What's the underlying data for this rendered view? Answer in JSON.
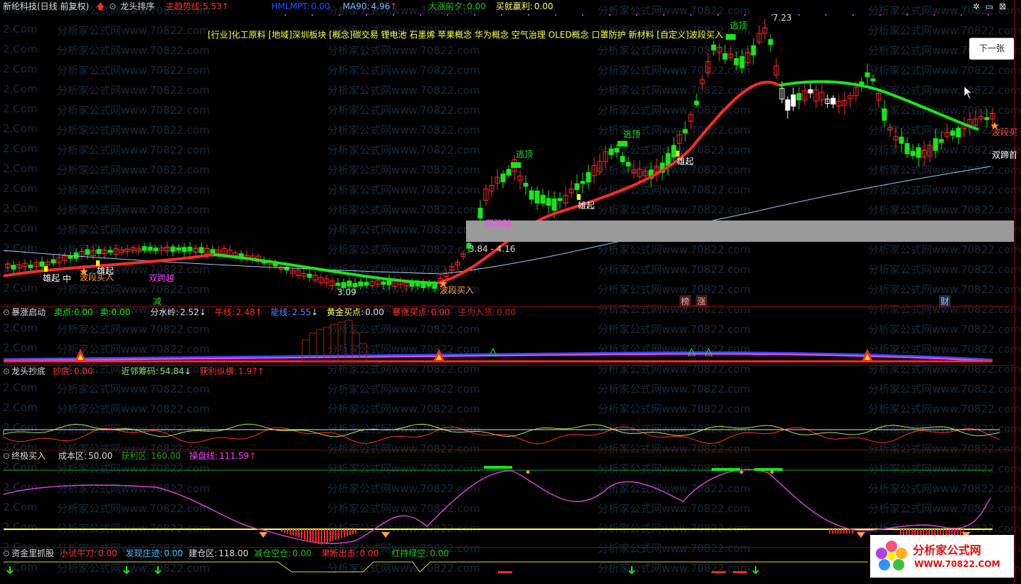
{
  "main_bar": {
    "title": "新纶科技(日线 前复权)",
    "sort_label": "龙头排序",
    "trend_label": "主趋势线:",
    "trend_value": "5.53",
    "hmlmpt_label": "HMLMPT:",
    "hmlmpt_value": "0.00",
    "ma90_label": "MA90:",
    "ma90_value": "4.96",
    "eve_label": "大涨前夕:",
    "eve_value": "0.00",
    "profit_label": "买就赢利:",
    "profit_value": "0.00"
  },
  "concepts": "[行业]化工原料 [地域]深圳板块 [概念]碳交易 锂电池 石墨烯 苹果概念 华为概念 空气治理 OLED概念 口罩防护 新材料 [自定义]波段买入",
  "next_button": "下一张",
  "price_labels": {
    "high": "7.23",
    "low": "3.09",
    "range": "3.84 - 4.16"
  },
  "chart_tags": {
    "escape1": "逃顶",
    "escape2": "逃顶",
    "escape3": "逃顶",
    "rise1": "雄起",
    "rise2": "雄起",
    "rise3": "雄起",
    "rise4": "雄起",
    "middle": "中",
    "double_cross1": "双跨越",
    "double_cross2": "双跨越",
    "band_buy1": "波段买入",
    "band_buy2": "波段买入",
    "band_buy3": "波段买",
    "double_hoof": "双蹄首",
    "reduce": "减",
    "list": "榜",
    "rise": "涨",
    "finance": "财"
  },
  "panel1": {
    "name": "暴涨启动",
    "sell_point_label": "卖点:",
    "sell_point_value": "0.00",
    "sell_label": "卖:",
    "sell_value": "0.00",
    "divide_label": "分水岭:",
    "divide_value": "2.52",
    "bull_label": "牛线:",
    "bull_value": "2.48",
    "energy_label": "能线:",
    "energy_value": "2.55",
    "gold_label": "黄金买点:",
    "gold_value": "0.00",
    "surge_label": "暴涨买点:",
    "surge_value": "0.00",
    "main_label": "主力入货:",
    "main_value": "0.00"
  },
  "panel2": {
    "name": "龙头抄底",
    "bottom_label": "抄底:",
    "bottom_value": "0.00",
    "near_label": "近邻筹码:",
    "near_value": "54.84",
    "profit_label": "获利纵横:",
    "profit_value": "1.97"
  },
  "panel3": {
    "name": "终极买入",
    "cost_label": "成本区:",
    "cost_value": "50.00",
    "gain_label": "获利区:",
    "gain_value": "160.00",
    "control_label": "操盘线:",
    "control_value": "111.59"
  },
  "panel4": {
    "name": "资金里抓股",
    "knife_label": "小试牛刀:",
    "knife_value": "0.00",
    "found_label": "发现庄迹:",
    "found_value": "0.00",
    "build_label": "建仓区:",
    "build_value": "118.00",
    "reduce_label": "减仓空仓:",
    "reduce_value": "0.00",
    "decisive_label": "果断出击:",
    "decisive_value": "0.00",
    "redgreen_label": "红持绿空:",
    "redgreen_value": "0.00"
  },
  "watermarks": {
    "site_cn": "分析家公式网www.70822.com",
    "site_short": "2.Com"
  },
  "logo": {
    "name": "分析家公式网",
    "url": "WWW.70822.COM"
  },
  "colors": {
    "up": "#ff2a2a",
    "down": "#19e619",
    "white": "#ffffff",
    "yellow": "#ffff00",
    "magenta": "#ff40ff",
    "cyan": "#40c0ff"
  }
}
